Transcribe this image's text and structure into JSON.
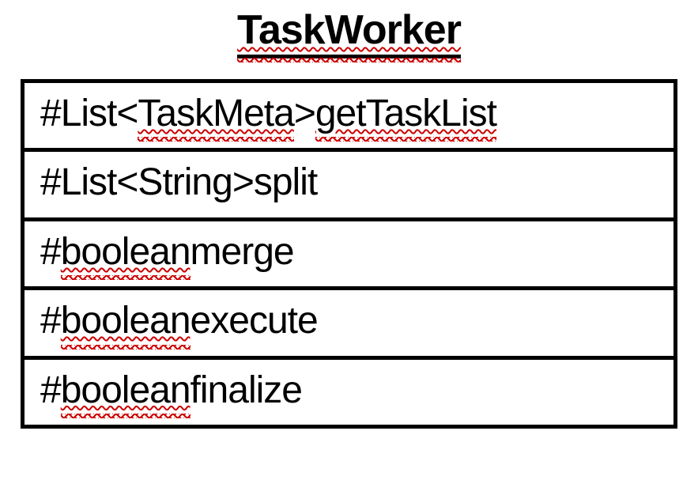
{
  "class": {
    "name": "TaskWorker",
    "operations": [
      {
        "prefix": "#List<",
        "type": "TaskMeta",
        "afterType": ">",
        "sep": " ",
        "name": "getTaskList",
        "typeSquiggle": true,
        "nameSquiggle": true
      },
      {
        "prefix": "#List<String> ",
        "type": "",
        "afterType": "",
        "sep": "",
        "name": "split",
        "typeSquiggle": false,
        "nameSquiggle": false
      },
      {
        "prefix": "#",
        "type": "boolean",
        "afterType": "",
        "sep": " ",
        "name": "merge",
        "typeSquiggle": true,
        "nameSquiggle": false
      },
      {
        "prefix": "#",
        "type": "boolean",
        "afterType": "",
        "sep": " ",
        "name": "execute",
        "typeSquiggle": true,
        "nameSquiggle": false
      },
      {
        "prefix": "#",
        "type": "boolean",
        "afterType": "",
        "sep": " ",
        "name": "finalize",
        "typeSquiggle": true,
        "nameSquiggle": false
      }
    ]
  }
}
